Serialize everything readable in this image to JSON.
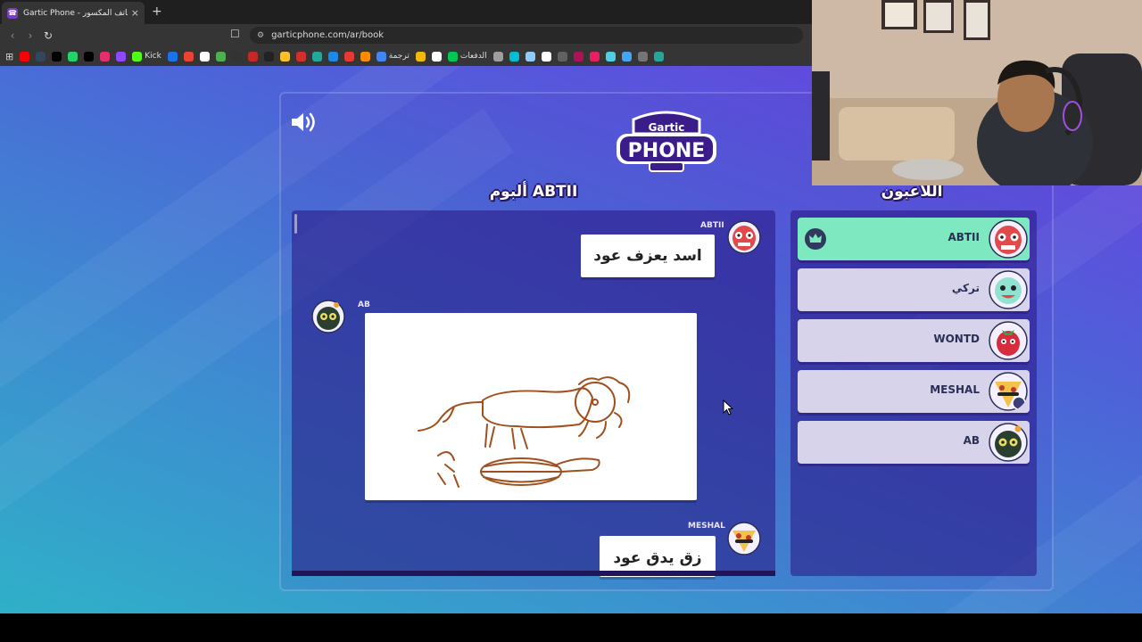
{
  "browser": {
    "tab_title": "Gartic Phone - لعبة الهاتف المكسور",
    "tab_close": "×",
    "new_tab": "+",
    "url": "garticphone.com/ar/book",
    "bookmarks": [
      {
        "label": "",
        "color": "#ff0000"
      },
      {
        "label": "",
        "color": "#35465c"
      },
      {
        "label": "",
        "color": "#000000"
      },
      {
        "label": "",
        "color": "#25d366"
      },
      {
        "label": "",
        "color": "#010101"
      },
      {
        "label": "",
        "color": "#e1306c"
      },
      {
        "label": "",
        "color": "#9146ff"
      },
      {
        "label": "Kick",
        "color": "#53fc18"
      },
      {
        "label": "",
        "color": "#1a73e8"
      },
      {
        "label": "",
        "color": "#ea4335"
      },
      {
        "label": "",
        "color": "#ffffff"
      },
      {
        "label": "",
        "color": "#4caf50"
      },
      {
        "label": "",
        "color": "#333333"
      },
      {
        "label": "",
        "color": "#c62828"
      },
      {
        "label": "",
        "color": "#222222"
      },
      {
        "label": "",
        "color": "#fbc02d"
      },
      {
        "label": "",
        "color": "#d32f2f"
      },
      {
        "label": "",
        "color": "#26a69a"
      },
      {
        "label": "",
        "color": "#1e88e5"
      },
      {
        "label": "",
        "color": "#e53935"
      },
      {
        "label": "",
        "color": "#fb8c00"
      },
      {
        "label": "ترجمة",
        "color": "#4285f4"
      },
      {
        "label": "",
        "color": "#f0b90b"
      },
      {
        "label": "",
        "color": "#ffffff"
      },
      {
        "label": "الدفعات",
        "color": "#00c853"
      },
      {
        "label": "",
        "color": "#9e9e9e"
      },
      {
        "label": "",
        "color": "#00bcd4"
      },
      {
        "label": "",
        "color": "#90caf9"
      },
      {
        "label": "",
        "color": "#ffffff"
      },
      {
        "label": "",
        "color": "#616161"
      },
      {
        "label": "",
        "color": "#ad1457"
      },
      {
        "label": "",
        "color": "#e91e63"
      },
      {
        "label": "",
        "color": "#4dd0e1"
      },
      {
        "label": "",
        "color": "#42a5f5"
      },
      {
        "label": "",
        "color": "#757575"
      },
      {
        "label": "",
        "color": "#26a69a"
      }
    ]
  },
  "game": {
    "album_title": "ألبوم ABTII",
    "players_title": "اللاعبون",
    "album": {
      "entries": [
        {
          "user": "ABTII",
          "text": "اسد يعزف عود"
        },
        {
          "user": "AB",
          "type": "drawing"
        },
        {
          "user": "MESHAL",
          "text": "زق يدق عود"
        }
      ]
    },
    "players": [
      {
        "name": "ABTII",
        "host": true,
        "color": "#7ee8c0"
      },
      {
        "name": "تركي"
      },
      {
        "name": "WONTD"
      },
      {
        "name": "MESHAL"
      },
      {
        "name": "AB"
      }
    ]
  },
  "colors": {
    "accent_green": "#7ee8c0",
    "drawing_stroke": "#a0501e"
  }
}
